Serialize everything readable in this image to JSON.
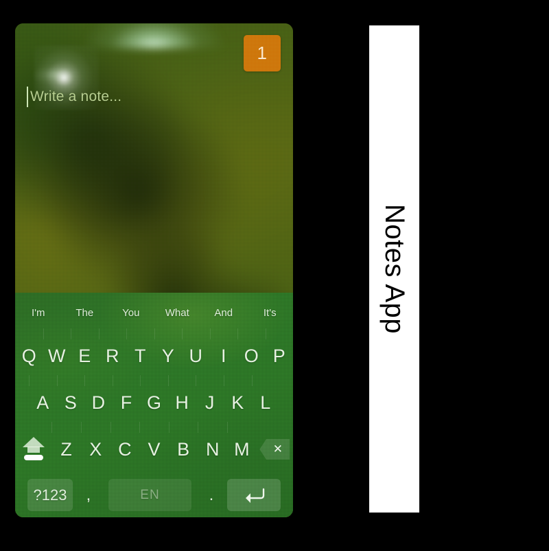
{
  "app": {
    "name": "Notes App",
    "panel_label": "Notes App"
  },
  "phone": {
    "note": {
      "placeholder": "Write a note...",
      "value": "",
      "caret_visible": true,
      "badge_count": "1",
      "badge_color": "#cf7a0c"
    },
    "keyboard": {
      "suggestions": [
        "I'm",
        "The",
        "You",
        "What",
        "And",
        "It's"
      ],
      "row1": [
        "Q",
        "W",
        "E",
        "R",
        "T",
        "Y",
        "U",
        "I",
        "O",
        "P"
      ],
      "row2": [
        "A",
        "S",
        "D",
        "F",
        "G",
        "H",
        "J",
        "K",
        "L"
      ],
      "row3_letters": [
        "Z",
        "X",
        "C",
        "V",
        "B",
        "N",
        "M"
      ],
      "shift_icon": "shift-up-arrow-icon",
      "backspace_icon": "backspace-delete-icon",
      "bottom_row": {
        "symbols_label": "?123",
        "comma_label": ",",
        "space_label": "EN",
        "period_label": ".",
        "enter_icon": "enter-return-icon"
      },
      "accent_color": "#2e7a27",
      "key_text_color": "#e8f2e4"
    }
  }
}
